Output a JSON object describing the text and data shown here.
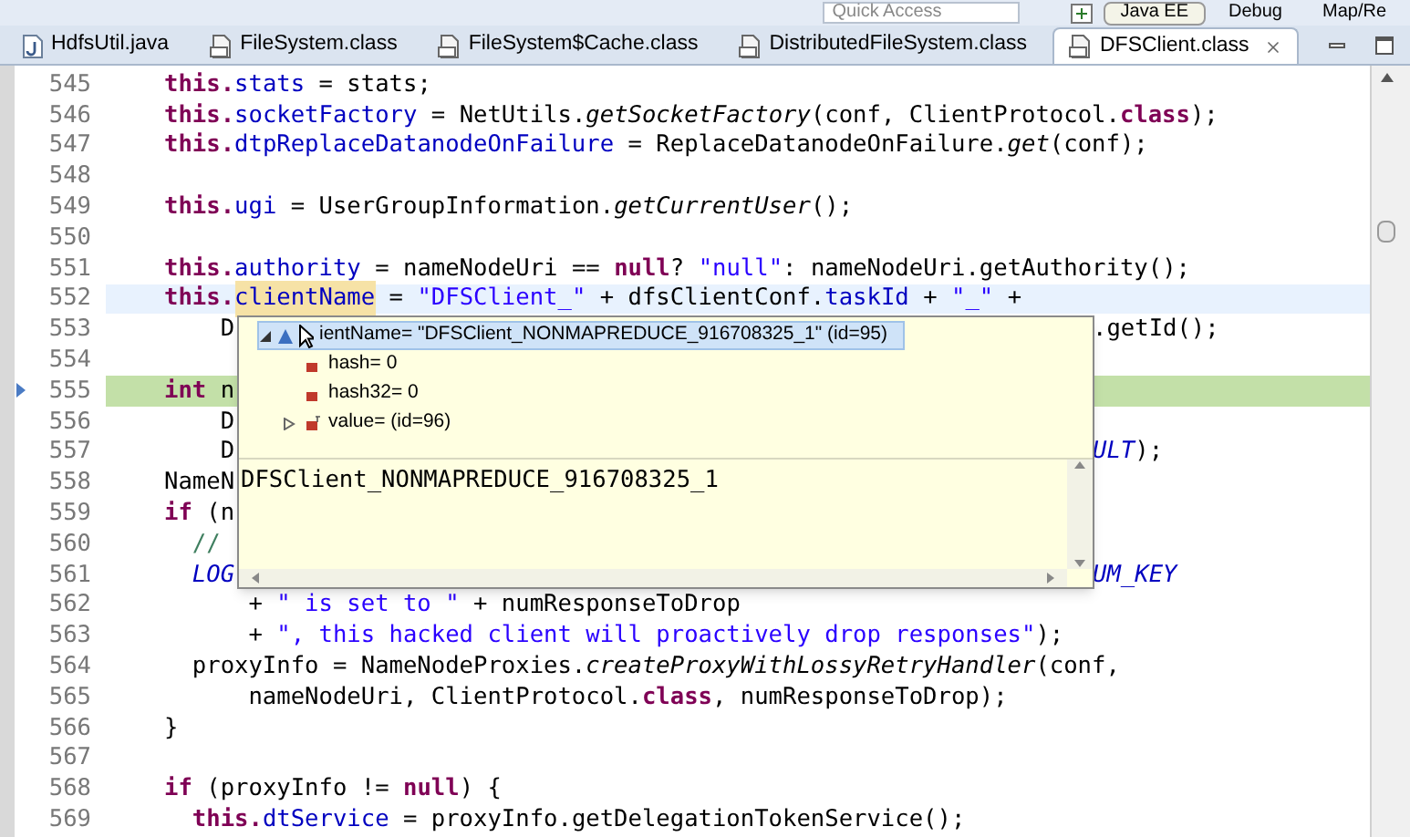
{
  "toolbar": {
    "quick_access": "Quick Access",
    "perspectives": [
      {
        "label": "Java EE",
        "selected": true
      },
      {
        "label": "Debug",
        "selected": false
      },
      {
        "label": "Map/Re",
        "selected": false
      }
    ]
  },
  "tabs": [
    {
      "label": "HdfsUtil.java",
      "kind": "java",
      "selected": false
    },
    {
      "label": "FileSystem.class",
      "kind": "class",
      "selected": false
    },
    {
      "label": "FileSystem$Cache.class",
      "kind": "class",
      "selected": false
    },
    {
      "label": "DistributedFileSystem.class",
      "kind": "class",
      "selected": false
    },
    {
      "label": "DFSClient.class",
      "kind": "class",
      "selected": true
    }
  ],
  "editor": {
    "lines": [
      {
        "number": "545",
        "current": false,
        "execution": false,
        "tokens": [
          {
            "kind": "keyword",
            "text": "this."
          },
          {
            "kind": "field",
            "text": "stats"
          },
          {
            "kind": "plain",
            "text": " = stats;"
          }
        ]
      },
      {
        "number": "546",
        "current": false,
        "execution": false,
        "tokens": [
          {
            "kind": "keyword",
            "text": "this."
          },
          {
            "kind": "field",
            "text": "socketFactory"
          },
          {
            "kind": "plain",
            "text": " = NetUtils."
          },
          {
            "kind": "method",
            "text": "getSocketFactory"
          },
          {
            "kind": "plain",
            "text": "(conf, ClientProtocol."
          },
          {
            "kind": "keyword",
            "text": "class"
          },
          {
            "kind": "plain",
            "text": ");"
          }
        ]
      },
      {
        "number": "547",
        "current": false,
        "execution": false,
        "tokens": [
          {
            "kind": "keyword",
            "text": "this."
          },
          {
            "kind": "field",
            "text": "dtpReplaceDatanodeOnFailure"
          },
          {
            "kind": "plain",
            "text": " = ReplaceDatanodeOnFailure."
          },
          {
            "kind": "method",
            "text": "get"
          },
          {
            "kind": "plain",
            "text": "(conf);"
          }
        ]
      },
      {
        "number": "548",
        "current": false,
        "execution": false
      },
      {
        "number": "549",
        "current": false,
        "execution": false,
        "tokens": [
          {
            "kind": "keyword",
            "text": "this."
          },
          {
            "kind": "field",
            "text": "ugi"
          },
          {
            "kind": "plain",
            "text": " = UserGroupInformation."
          },
          {
            "kind": "method",
            "text": "getCurrentUser"
          },
          {
            "kind": "plain",
            "text": "();"
          }
        ]
      },
      {
        "number": "550",
        "current": false,
        "execution": false
      },
      {
        "number": "551",
        "current": false,
        "execution": false,
        "tokens": [
          {
            "kind": "keyword",
            "text": "this."
          },
          {
            "kind": "field",
            "text": "authority"
          },
          {
            "kind": "plain",
            "text": " = nameNodeUri == "
          },
          {
            "kind": "keyword",
            "text": "null"
          },
          {
            "kind": "plain",
            "text": "? "
          },
          {
            "kind": "string",
            "text": "\"null\""
          },
          {
            "kind": "plain",
            "text": ": nameNodeUri.getAuthority();"
          }
        ]
      },
      {
        "number": "552",
        "current": true,
        "execution": false,
        "tokens": [
          {
            "kind": "keyword",
            "text": "this."
          },
          {
            "kind": "occurrence",
            "text": "clientName"
          },
          {
            "kind": "plain",
            "text": " = "
          },
          {
            "kind": "string",
            "text": "\"DFSClient_\""
          },
          {
            "kind": "plain",
            "text": " + dfsClientConf."
          },
          {
            "kind": "field",
            "text": "taskId"
          },
          {
            "kind": "plain",
            "text": " + "
          },
          {
            "kind": "string",
            "text": "\"_\""
          },
          {
            "kind": "plain",
            "text": " +"
          }
        ]
      },
      {
        "number": "553",
        "current": false,
        "execution": false,
        "tokens": [
          {
            "kind": "plain",
            "text": "    D"
          }
        ],
        "right": [
          {
            "kind": "plain",
            "text": ".getId();"
          }
        ]
      },
      {
        "number": "554",
        "current": false,
        "execution": false
      },
      {
        "number": "555",
        "current": false,
        "execution": true,
        "tokens": [
          {
            "kind": "keyword",
            "text": "int"
          },
          {
            "kind": "plain",
            "text": " n"
          }
        ]
      },
      {
        "number": "556",
        "current": false,
        "execution": false,
        "tokens": [
          {
            "kind": "plain",
            "text": "    D"
          }
        ]
      },
      {
        "number": "557",
        "current": false,
        "execution": false,
        "tokens": [
          {
            "kind": "plain",
            "text": "    D"
          }
        ],
        "right": [
          {
            "kind": "constant",
            "text": "ULT"
          },
          {
            "kind": "plain",
            "text": ");"
          }
        ]
      },
      {
        "number": "558",
        "current": false,
        "execution": false,
        "tokens": [
          {
            "kind": "plain",
            "text": "NameN"
          }
        ]
      },
      {
        "number": "559",
        "current": false,
        "execution": false,
        "tokens": [
          {
            "kind": "keyword",
            "text": "if"
          },
          {
            "kind": "plain",
            "text": " (n"
          }
        ]
      },
      {
        "number": "560",
        "current": false,
        "execution": false,
        "tokens": [
          {
            "kind": "comment",
            "text": "  //"
          }
        ]
      },
      {
        "number": "561",
        "current": false,
        "execution": false,
        "tokens": [
          {
            "kind": "constant",
            "text": "  LOG"
          }
        ],
        "right": [
          {
            "kind": "constant",
            "text": "UM_KEY"
          }
        ]
      },
      {
        "number": "562",
        "current": false,
        "execution": false,
        "tokens": [
          {
            "kind": "plain",
            "text": "      + "
          },
          {
            "kind": "string",
            "text": "\" is set to \""
          },
          {
            "kind": "plain",
            "text": " + numResponseToDrop"
          }
        ]
      },
      {
        "number": "563",
        "current": false,
        "execution": false,
        "tokens": [
          {
            "kind": "plain",
            "text": "      + "
          },
          {
            "kind": "string",
            "text": "\", this hacked client will proactively drop responses\""
          },
          {
            "kind": "plain",
            "text": ");"
          }
        ]
      },
      {
        "number": "564",
        "current": false,
        "execution": false,
        "tokens": [
          {
            "kind": "plain",
            "text": "  proxyInfo = NameNodeProxies."
          },
          {
            "kind": "method",
            "text": "createProxyWithLossyRetryHandler"
          },
          {
            "kind": "plain",
            "text": "(conf,"
          }
        ]
      },
      {
        "number": "565",
        "current": false,
        "execution": false,
        "tokens": [
          {
            "kind": "plain",
            "text": "      nameNodeUri, ClientProtocol."
          },
          {
            "kind": "keyword",
            "text": "class"
          },
          {
            "kind": "plain",
            "text": ", numResponseToDrop);"
          }
        ]
      },
      {
        "number": "566",
        "current": false,
        "execution": false,
        "tokens": [
          {
            "kind": "plain",
            "text": "}"
          }
        ]
      },
      {
        "number": "567",
        "current": false,
        "execution": false
      },
      {
        "number": "568",
        "current": false,
        "execution": false,
        "tokens": [
          {
            "kind": "keyword",
            "text": "if"
          },
          {
            "kind": "plain",
            "text": " (proxyInfo != "
          },
          {
            "kind": "keyword",
            "text": "null"
          },
          {
            "kind": "plain",
            "text": ") {"
          }
        ]
      },
      {
        "number": "569",
        "current": false,
        "execution": false,
        "tokens": [
          {
            "kind": "keyword",
            "text": "  this."
          },
          {
            "kind": "field",
            "text": "dtService"
          },
          {
            "kind": "plain",
            "text": " = proxyInfo.getDelegationTokenService();"
          }
        ]
      }
    ]
  },
  "hover": {
    "variable": {
      "text": "ientName= \"DFSClient_NONMAPREDUCE_916708325_1\" (id=95)",
      "selected": true,
      "expanded": true,
      "children": [
        {
          "text": "hash= 0",
          "kind": "primitive"
        },
        {
          "text": "hash32= 0",
          "kind": "primitive"
        },
        {
          "text": "value= (id=96)",
          "kind": "object",
          "expanded": false
        }
      ]
    },
    "detail": "DFSClient_NONMAPREDUCE_916708325_1"
  }
}
